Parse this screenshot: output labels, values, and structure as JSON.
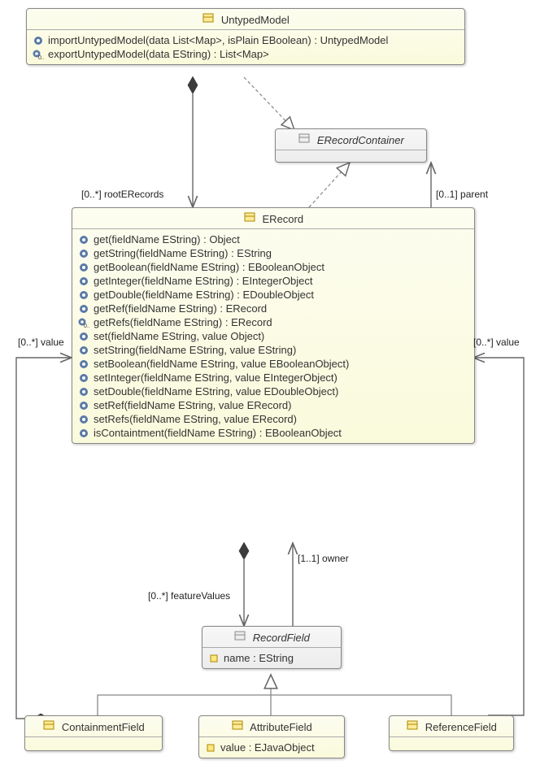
{
  "classes": {
    "UntypedModel": {
      "name": "UntypedModel",
      "ops": [
        "importUntypedModel(data List<Map>, isPlain EBoolean) : UntypedModel",
        "exportUntypedModel(data EString) : List<Map>"
      ]
    },
    "ERecordContainer": {
      "name": "ERecordContainer"
    },
    "ERecord": {
      "name": "ERecord",
      "ops": [
        "get(fieldName EString) : Object",
        "getString(fieldName EString) : EString",
        "getBoolean(fieldName EString) : EBooleanObject",
        "getInteger(fieldName EString) : EIntegerObject",
        "getDouble(fieldName EString) : EDoubleObject",
        "getRef(fieldName EString) : ERecord",
        "getRefs(fieldName EString) : ERecord",
        "set(fieldName EString, value Object)",
        "setString(fieldName EString, value EString)",
        "setBoolean(fieldName EString, value EBooleanObject)",
        "setInteger(fieldName EString, value EIntegerObject)",
        "setDouble(fieldName EString, value EDoubleObject)",
        "setRef(fieldName EString, value ERecord)",
        "setRefs(fieldName EString, value ERecord)",
        "isContaintment(fieldName EString) : EBooleanObject"
      ]
    },
    "RecordField": {
      "name": "RecordField",
      "attrs": [
        "name : EString"
      ]
    },
    "ContainmentField": {
      "name": "ContainmentField"
    },
    "AttributeField": {
      "name": "AttributeField",
      "attrs": [
        "value : EJavaObject"
      ]
    },
    "ReferenceField": {
      "name": "ReferenceField"
    }
  },
  "labels": {
    "rootERecords": "[0..*] rootERecords",
    "parent": "[0..1] parent",
    "valueLeft": "[0..*] value",
    "valueRight": "[0..*] value",
    "featureValues": "[0..*] featureValues",
    "owner": "[1..1] owner"
  }
}
